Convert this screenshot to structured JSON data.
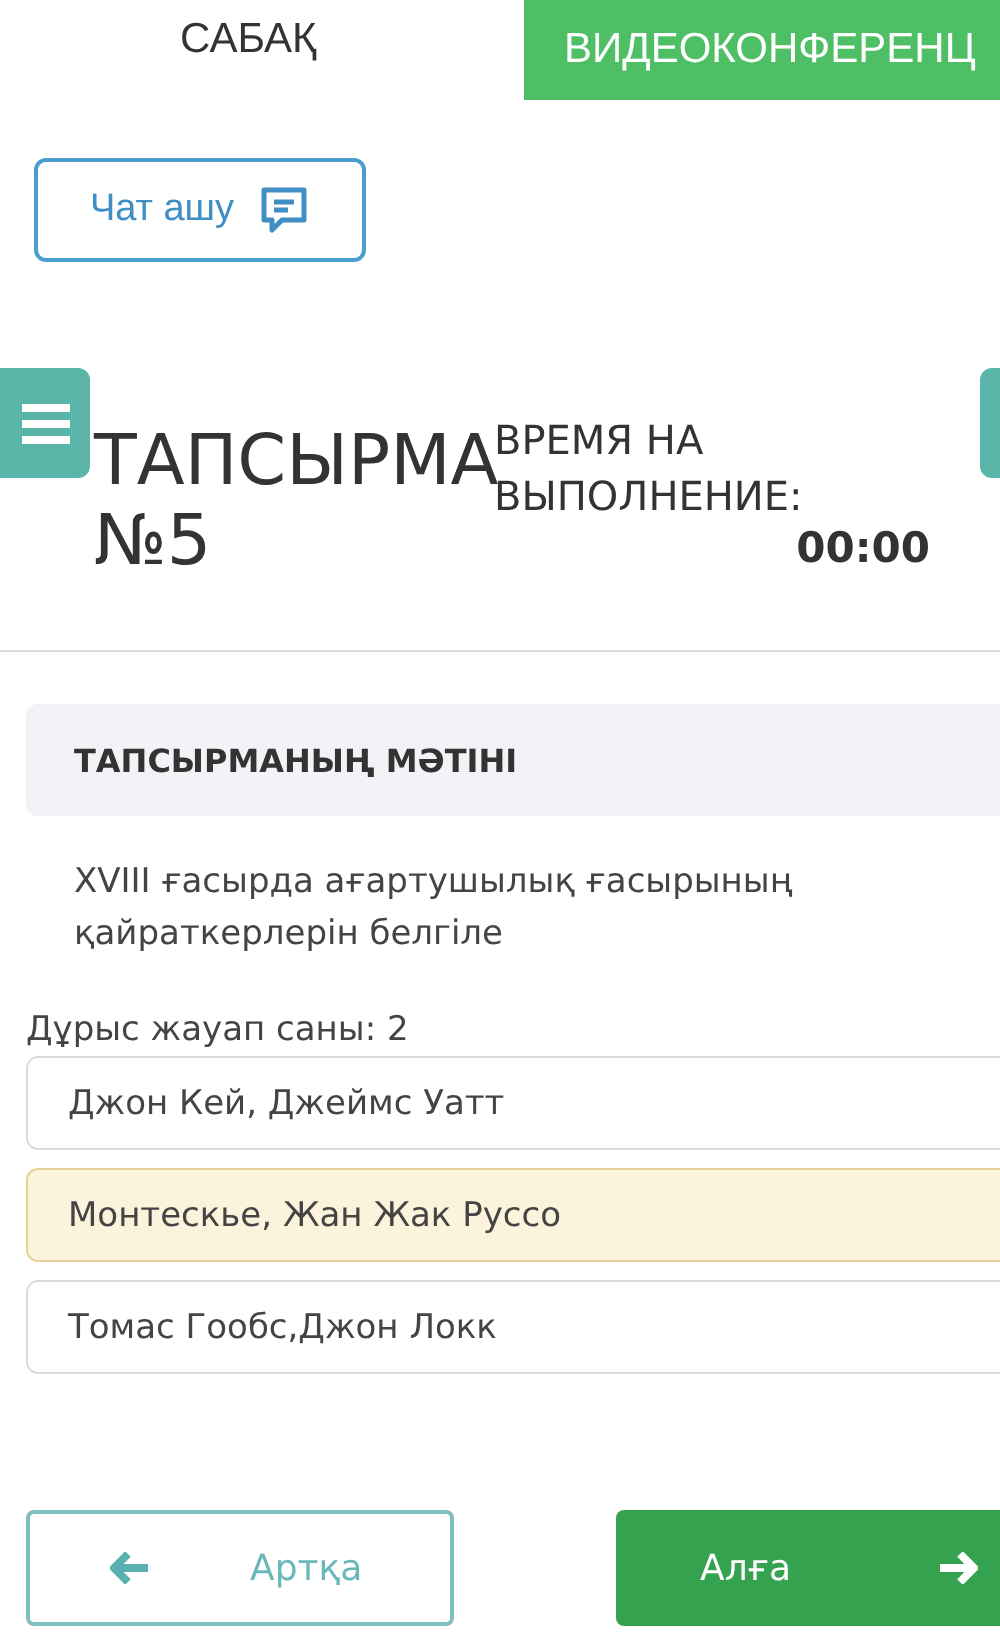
{
  "tabs": [
    {
      "label": "САБАҚ",
      "selected": true
    },
    {
      "label": "ВИДЕОКОНФЕРЕНЦ",
      "selected": false
    }
  ],
  "chat_button": {
    "label": "Чат ашу"
  },
  "task": {
    "title_line1": "ТАПСЫРМА",
    "title_line2": "№5",
    "timer_label": "ВРЕМЯ НА ВЫПОЛНЕНИЕ:",
    "timer_value": "00:00"
  },
  "task_text": {
    "heading": "ТАПСЫРМАНЫҢ МӘТІНІ",
    "question": "XVIII ғасырда ағартушылық ғасырының қайраткерлерін белгіле"
  },
  "answer_count": "Дұрыс жауап саны: 2",
  "answers": [
    {
      "label": "Джон Кей, Джеймс Уатт",
      "selected": false
    },
    {
      "label": "Монтескье, Жан Жак Руссо",
      "selected": true
    },
    {
      "label": "Томас Гообс,Джон Локк",
      "selected": false
    }
  ],
  "nav": {
    "back": "Артқа",
    "next": "Алға"
  }
}
